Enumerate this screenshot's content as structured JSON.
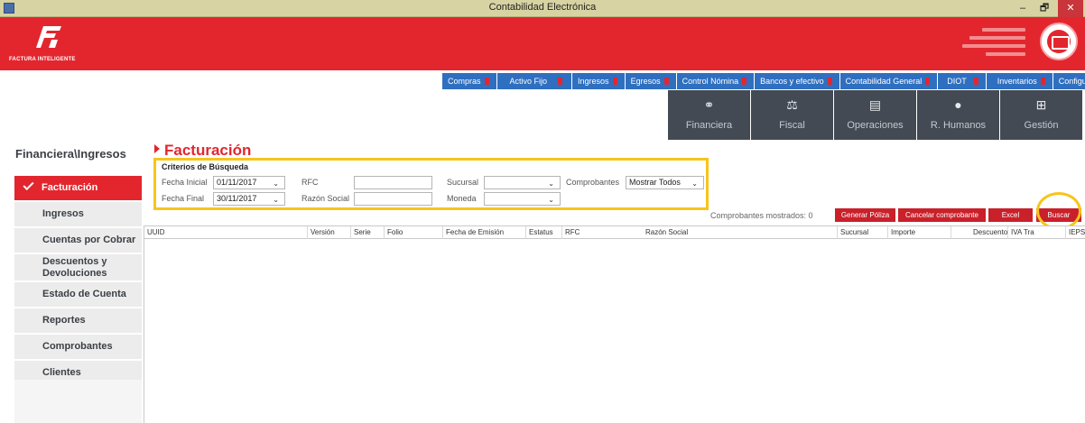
{
  "window": {
    "title": "Contabilidad Electrónica",
    "minimize": "–",
    "maximize": "🗗",
    "close": "✕"
  },
  "brand": {
    "logo_text": "FACTURA INTELIGENTE",
    "color": "#e3262e"
  },
  "menu": [
    {
      "label": "Compras"
    },
    {
      "label": "Activo Fijo"
    },
    {
      "label": "Ingresos"
    },
    {
      "label": "Egresos"
    },
    {
      "label": "Control Nómina"
    },
    {
      "label": "Bancos y efectivo"
    },
    {
      "label": "Contabilidad General"
    },
    {
      "label": "DIOT"
    },
    {
      "label": "Inventarios"
    },
    {
      "label": "Configuración"
    }
  ],
  "modules": [
    {
      "label": "Financiera",
      "icon": "rings-icon"
    },
    {
      "label": "Fiscal",
      "icon": "scale-icon"
    },
    {
      "label": "Operaciones",
      "icon": "document-icon"
    },
    {
      "label": "R. Humanos",
      "icon": "person-icon"
    },
    {
      "label": "Gestión",
      "icon": "org-chart-icon"
    }
  ],
  "sidebar": {
    "title": "Financiera\\Ingresos",
    "items": [
      {
        "label": "Facturación",
        "active": true
      },
      {
        "label": "Ingresos"
      },
      {
        "label": "Cuentas por Cobrar"
      },
      {
        "label": "Descuentos y Devoluciones"
      },
      {
        "label": "Estado de Cuenta"
      },
      {
        "label": "Reportes"
      },
      {
        "label": "Comprobantes"
      },
      {
        "label": "Clientes"
      }
    ]
  },
  "page": {
    "title": "Facturación"
  },
  "criteria": {
    "title": "Criterios de Búsqueda",
    "fecha_inicial_label": "Fecha Inicial",
    "fecha_inicial_value": "01/11/2017",
    "fecha_final_label": "Fecha Final",
    "fecha_final_value": "30/11/2017",
    "rfc_label": "RFC",
    "rfc_value": "",
    "razon_social_label": "Razón Social",
    "razon_social_value": "",
    "sucursal_label": "Sucursal",
    "sucursal_value": "",
    "moneda_label": "Moneda",
    "moneda_value": "",
    "comprobantes_label": "Comprobantes",
    "comprobantes_value": "Mostrar Todos"
  },
  "actions": {
    "shown_text": "Comprobantes mostrados: 0",
    "generar_poliza": "Generar Póliza",
    "cancelar_comprobante": "Cancelar comprobante",
    "excel": "Excel",
    "buscar": "Buscar"
  },
  "grid": {
    "columns": [
      "UUID",
      "Versión",
      "Serie",
      "Folio",
      "Fecha de Emisión",
      "Estatus",
      "RFC",
      "Razón Social",
      "Sucursal",
      "Importe",
      "Descuento",
      "IVA Tra",
      "IEPS"
    ]
  }
}
